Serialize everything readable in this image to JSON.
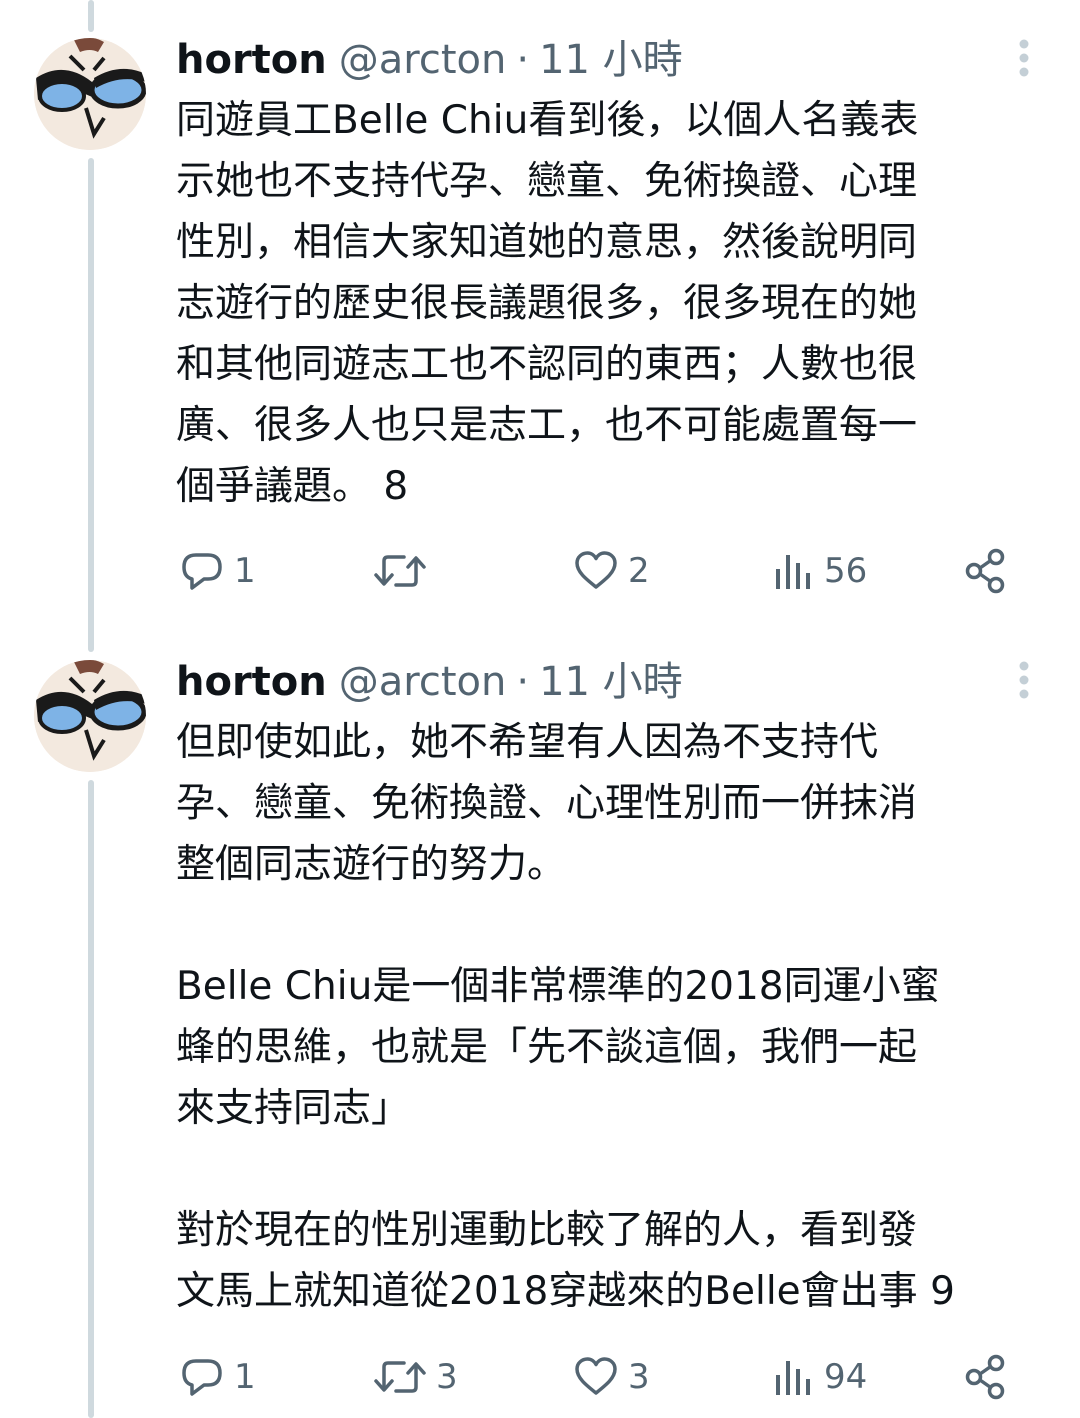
{
  "tweets": [
    {
      "name": "horton",
      "handle": "@arcton",
      "separator": "·",
      "time": "11 小時",
      "text": "同遊員工Belle Chiu看到後，以個人名義表\n示她也不支持代孕、戀童、免術換證、心理\n性別，相信大家知道她的意思，然後說明同\n志遊行的歷史很長議題很多，很多現在的她\n和其他同遊志工也不認同的東西；人數也很\n廣、很多人也只是志工，也不可能處置每一\n個爭議題。 8",
      "reply_count": "1",
      "retweet_count": "",
      "like_count": "2",
      "view_count": "56"
    },
    {
      "name": "horton",
      "handle": "@arcton",
      "separator": "·",
      "time": "11 小時",
      "text": "但即使如此，她不希望有人因為不支持代\n孕、戀童、免術換證、心理性別而一併抹消\n整個同志遊行的努力。\n\nBelle Chiu是一個非常標準的2018同運小蜜\n蜂的思維，也就是「先不談這個，我們一起\n來支持同志」\n\n對於現在的性別運動比較了解的人，看到發\n文馬上就知道從2018穿越來的Belle會出事 9",
      "reply_count": "1",
      "retweet_count": "3",
      "like_count": "3",
      "view_count": "94"
    }
  ],
  "icons": {
    "reply": "reply-icon",
    "retweet": "retweet-icon",
    "like": "heart-icon",
    "views": "views-icon",
    "share": "share-icon",
    "more": "more-vertical-icon"
  },
  "colors": {
    "text": "#0f1419",
    "secondary": "#536471",
    "thread_line": "#cfd9de"
  }
}
